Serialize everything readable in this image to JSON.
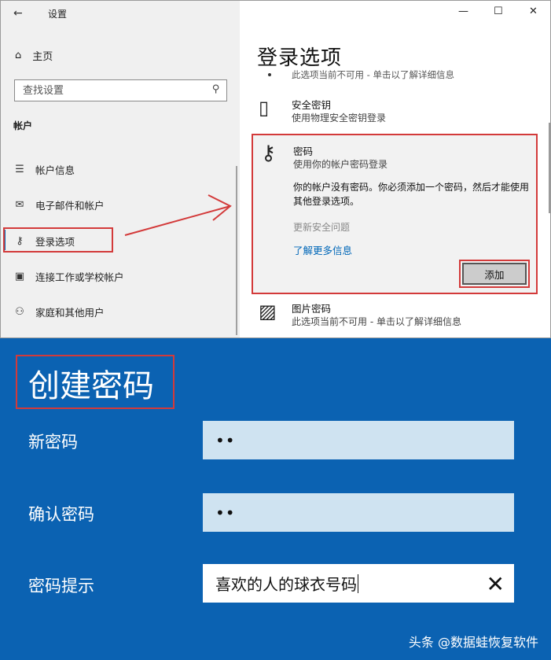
{
  "settings": {
    "window_title": "设置",
    "back_icon": "back-arrow-icon",
    "home": {
      "icon": "home-icon",
      "label": "主页"
    },
    "search": {
      "placeholder": "查找设置",
      "icon": "search-icon"
    },
    "section_label": "帐户",
    "nav": [
      {
        "icon": "account-info-icon",
        "label": "帐户信息"
      },
      {
        "icon": "mail-icon",
        "label": "电子邮件和帐户"
      },
      {
        "icon": "key-icon",
        "label": "登录选项",
        "selected": true
      },
      {
        "icon": "briefcase-icon",
        "label": "连接工作或学校帐户"
      },
      {
        "icon": "person-add-icon",
        "label": "家庭和其他用户"
      }
    ],
    "window_controls": {
      "minimize": "—",
      "maximize": "☐",
      "close": "✕"
    }
  },
  "signin": {
    "title": "登录选项",
    "clipped_text": "此选项当前不可用 - 单击以了解详细信息",
    "security_key": {
      "title": "安全密钥",
      "subtitle": "使用物理安全密钥登录",
      "icon": "usb-key-icon"
    },
    "password": {
      "title": "密码",
      "subtitle": "使用你的帐户密码登录",
      "icon": "key-icon",
      "message": "你的帐户没有密码。你必须添加一个密码，然后才能使用其他登录选项。",
      "security_question": "更新安全问题",
      "learn_more": "了解更多信息",
      "add_button": "添加"
    },
    "picture_password": {
      "title": "图片密码",
      "subtitle": "此选项当前不可用 - 单击以了解详细信息",
      "icon": "picture-icon"
    }
  },
  "create_password": {
    "title": "创建密码",
    "new_password": {
      "label": "新密码",
      "value": "••"
    },
    "confirm_password": {
      "label": "确认密码",
      "value": "••"
    },
    "hint": {
      "label": "密码提示",
      "value": "喜欢的人的球衣号码",
      "clear_icon": "clear-icon"
    }
  },
  "watermark": "头条 @数据蛙恢复软件",
  "colors": {
    "dialog_bg": "#0b62b2",
    "highlight": "#d33a3a",
    "link": "#0067b8",
    "field_bg": "#cfe3f1"
  }
}
